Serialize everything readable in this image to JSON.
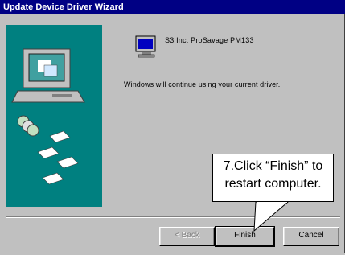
{
  "window": {
    "title": "Update Device Driver Wizard"
  },
  "device": {
    "name": "S3 Inc. ProSavage PM133",
    "icon": "monitor-icon"
  },
  "message": "Windows will continue using your current driver.",
  "buttons": {
    "back_label": "< Back",
    "finish_label": "Finish",
    "cancel_label": "Cancel"
  },
  "callout": {
    "line1": "7.Click “Finish” to",
    "line2": "restart computer."
  },
  "colors": {
    "titlebar": "#000084",
    "panel": "#008080",
    "face": "#c0c0c0"
  }
}
